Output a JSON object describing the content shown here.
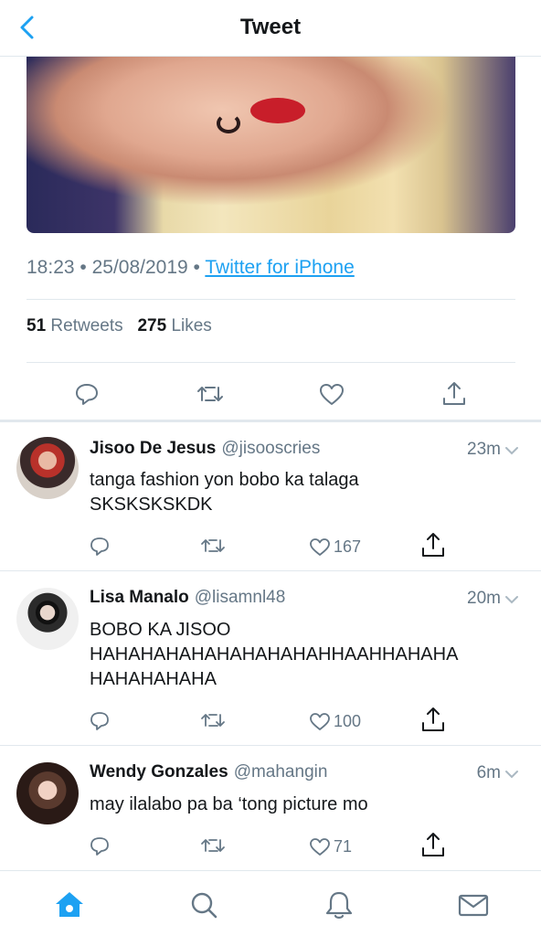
{
  "header": {
    "title": "Tweet",
    "back_icon": "chevron-left-icon"
  },
  "tweet": {
    "time": "18:23",
    "date": "25/08/2019",
    "source": "Twitter for iPhone",
    "retweets_count": "51",
    "retweets_label": "Retweets",
    "likes_count": "275",
    "likes_label": "Likes"
  },
  "replies": [
    {
      "name": "Jisoo De Jesus",
      "handle": "@jisooscries",
      "time": "23m",
      "text_lines": [
        "tanga fashion yon bobo ka talaga",
        "SKSKSKSKDK"
      ],
      "likes": "167"
    },
    {
      "name": "Lisa Manalo",
      "handle": "@lisamnl48",
      "time": "20m",
      "text_lines": [
        "BOBO KA JISOO",
        "HAHAHAHAHAHAHAHAHAHHAAHHAHAHA",
        "HAHAHAHAHA"
      ],
      "likes": "100"
    },
    {
      "name": "Wendy Gonzales",
      "handle": "@mahangin",
      "time": "6m",
      "text_lines": [
        "may ilalabo pa ba ‘tong picture mo"
      ],
      "likes": "71"
    }
  ],
  "tabbar": {
    "items": [
      "home-icon",
      "search-icon",
      "notifications-icon",
      "messages-icon"
    ]
  },
  "colors": {
    "accent": "#1da1f2",
    "secondary_text": "#657786",
    "divider": "#e1e8ed"
  }
}
